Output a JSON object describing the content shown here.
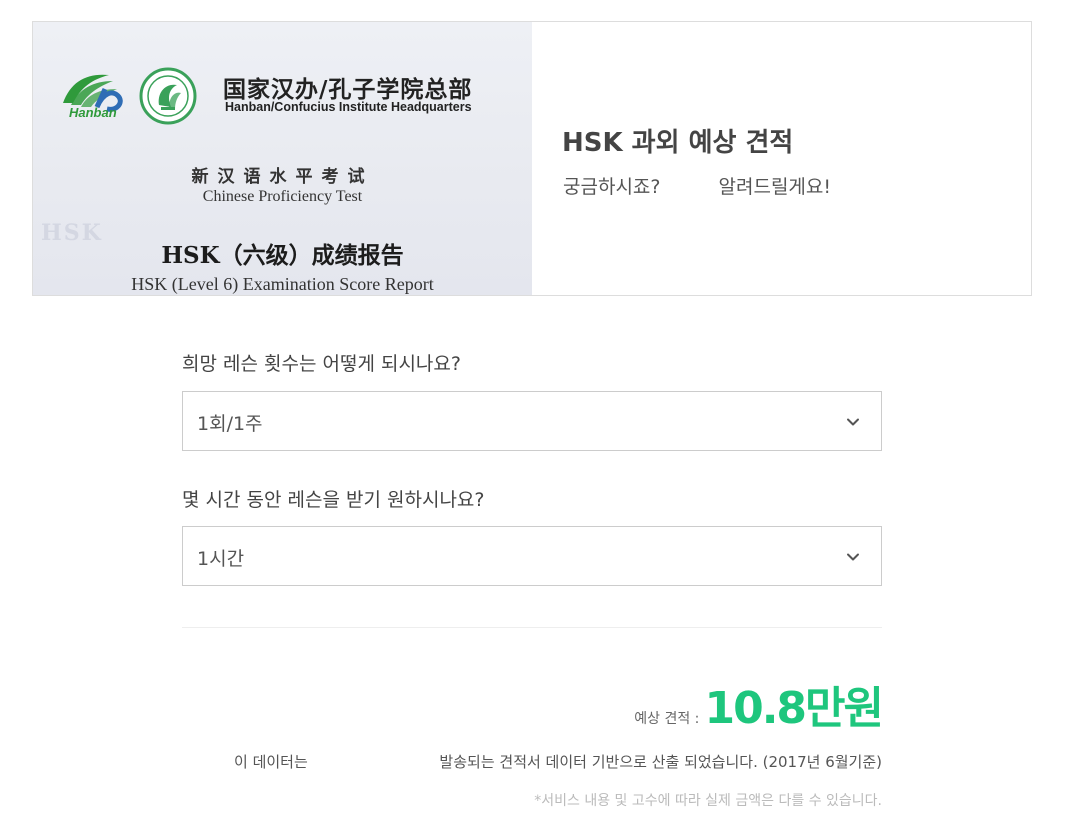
{
  "banner": {
    "certificate": {
      "logo_text": "Hanban",
      "org_cn": "国家汉办/孔子学院总部",
      "org_en": "Hanban/Confucius Institute Headquarters",
      "test_cn": "新汉语水平考试",
      "test_en": "Chinese Proficiency Test",
      "report_cn": "HSK（六级）成绩报告",
      "report_en": "HSK (Level 6) Examination Score Report",
      "watermark": "HSK"
    },
    "title": "HSK 과외 예상 견적",
    "subtitle_left": "궁금하시죠?",
    "subtitle_right": "알려드릴게요!"
  },
  "form": {
    "lesson_count": {
      "question": "희망 레슨 횟수는 어떻게 되시나요?",
      "selected": "1회/1주"
    },
    "lesson_duration": {
      "question": "몇 시간 동안 레슨을 받기 원하시나요?",
      "selected": "1시간"
    }
  },
  "estimate": {
    "label": "예상 견적 :",
    "value": "10.8만원",
    "accent_color": "#1ec67d"
  },
  "notes": {
    "data_prefix": "이 데이터는",
    "data_basis": "발송되는 견적서 데이터 기반으로 산출 되었습니다. (2017년 6월기준)",
    "disclaimer": "*서비스 내용 및 고수에 따라 실제 금액은 다를 수 있습니다."
  }
}
